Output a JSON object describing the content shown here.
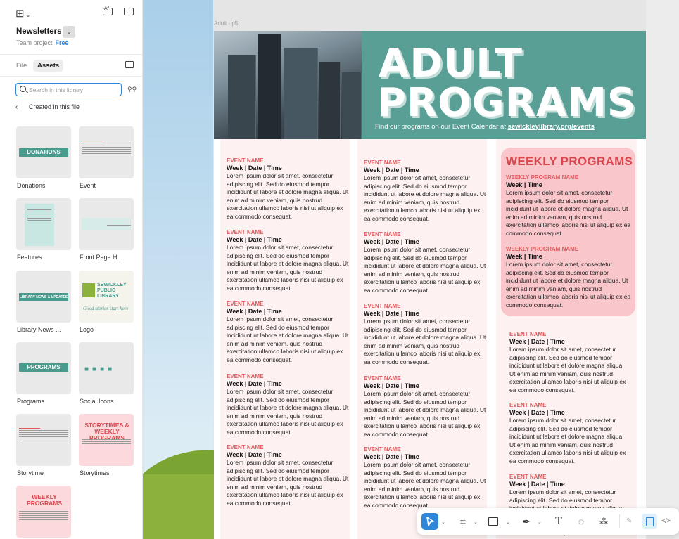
{
  "sidebar": {
    "file_name": "Newsletters",
    "team": "Team project",
    "plan": "Free",
    "tabs": [
      "File",
      "Assets"
    ],
    "search_placeholder": "Search in this library",
    "breadcrumb": "Created in this file",
    "assets": [
      {
        "label": "Donations",
        "chip": "DONATIONS"
      },
      {
        "label": "Event"
      },
      {
        "label": "Features"
      },
      {
        "label": "Front Page H..."
      },
      {
        "label": "Library News ...",
        "chip": "LIBRARY NEWS & UPDATES"
      },
      {
        "label": "Logo",
        "logo_text": "SEWICKLEY PUBLIC LIBRARY",
        "tagline": "Good stories start here"
      },
      {
        "label": "Programs",
        "chip": "PROGRAMS"
      },
      {
        "label": "Social Icons"
      },
      {
        "label": "Storytime"
      },
      {
        "label": "Storytimes",
        "heading": "STORYTIMES & WEEKLY PROGRAMS"
      },
      {
        "label": "",
        "heading": "WEEKLY PROGRAMS"
      }
    ]
  },
  "canvas": {
    "frame_label": "Adult - p5",
    "hero": {
      "title_line1": "ADULT",
      "title_line2": "PROGRAMS",
      "subtitle": "Find our programs on our Event Calendar at",
      "link": "sewickleylibrary.org/events"
    },
    "event": {
      "name": "EVENT NAME",
      "when": "Week | Date | Time",
      "body": "Lorem ipsum dolor sit amet, consectetur adipiscing elit. Sed do eiusmod tempor incididunt ut labore et dolore magna aliqua. Ut enim ad minim veniam, quis nostrud exercitation ullamco laboris nisi ut aliquip ex ea commodo consequat."
    },
    "weekly": {
      "title": "WEEKLY PROGRAMS",
      "program_name": "WEEKLY PROGRAM NAME",
      "when": "Week | Time",
      "body": "Lorem ipsum dolor sit amet, consectetur adipiscing elit. Sed do eiusmod tempor incididunt ut labore et dolore magna aliqua. Ut enim ad minim veniam, quis nostrud exercitation ullamco laboris nisi ut aliquip ex ea commodo consequat."
    },
    "bottom_peek": "ut aliquip ex ea commodo consequat."
  },
  "toolbar": {
    "tools": [
      "move-tool",
      "frame-tool",
      "shape-tool",
      "pen-tool",
      "text-tool",
      "comment-tool",
      "actions-tool",
      "draw-mode",
      "dev-mode",
      "code-mode"
    ],
    "text_tool_glyph": "T",
    "code_glyph": "</>"
  }
}
